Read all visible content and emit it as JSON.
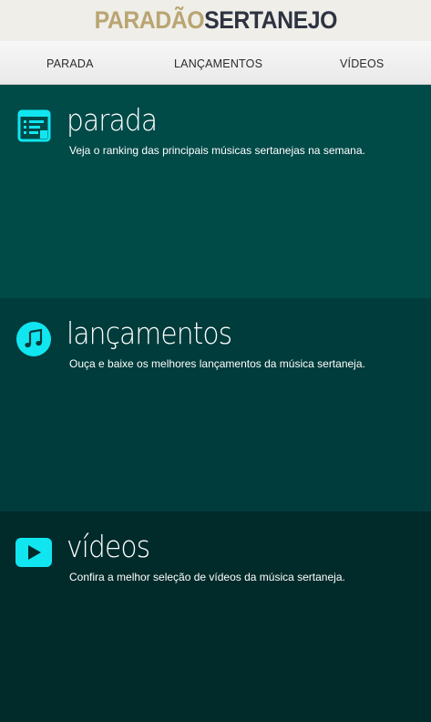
{
  "header": {
    "logo_part1": "PARADÃO",
    "logo_part2": "SERTANEJO"
  },
  "nav": {
    "items": [
      {
        "label": "PARADA"
      },
      {
        "label": "LANÇAMENTOS"
      },
      {
        "label": "VÍDEOS"
      }
    ]
  },
  "sections": [
    {
      "title": "parada",
      "description": "Veja o ranking das principais músicas sertanejas na semana.",
      "icon": "chart-list-icon"
    },
    {
      "title": "lançamentos",
      "description": "Ouça e baixe os melhores lançamentos da música sertaneja.",
      "icon": "music-note-icon"
    },
    {
      "title": "vídeos",
      "description": "Confira a melhor seleção de vídeos da música sertaneja.",
      "icon": "play-video-icon"
    }
  ],
  "colors": {
    "accent_icon": "#11e6f0",
    "logo_gold": "#b9a572",
    "logo_dark": "#2e3341",
    "section1_bg": "#004a48",
    "section2_bg": "#003c3b",
    "section3_bg": "#012a2a"
  }
}
